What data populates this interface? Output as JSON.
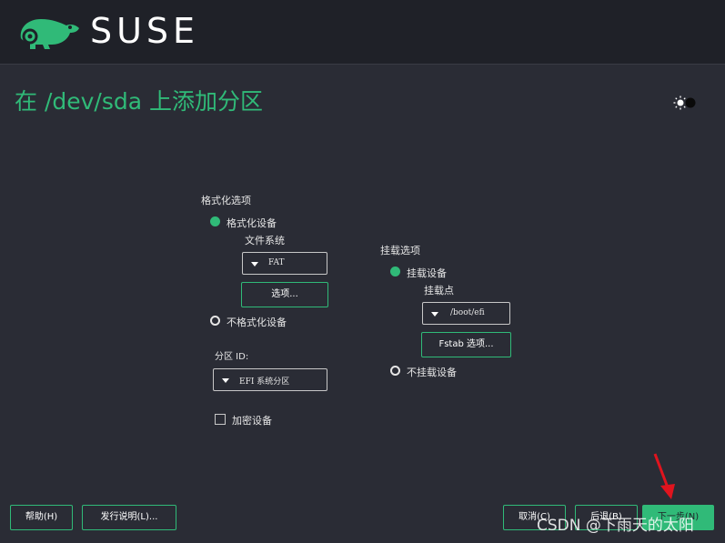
{
  "header": {
    "brand": "SUSE"
  },
  "page": {
    "title": "在 /dev/sda 上添加分区"
  },
  "format_section": {
    "label": "格式化选项",
    "format_device_label": "格式化设备",
    "filesystem_label": "文件系统",
    "filesystem_value": "FAT",
    "options_button": "选项...",
    "no_format_label": "不格式化设备",
    "partition_id_label": "分区 ID:",
    "partition_id_value": "EFI 系统分区",
    "encrypt_label": "加密设备"
  },
  "mount_section": {
    "label": "挂载选项",
    "mount_device_label": "挂载设备",
    "mount_point_label": "挂载点",
    "mount_point_value": "/boot/efi",
    "fstab_button": "Fstab 选项...",
    "no_mount_label": "不挂载设备"
  },
  "footer": {
    "help_button": "帮助(H)",
    "release_notes_button": "发行说明(L)...",
    "cancel_button": "取消(C)",
    "back_button": "后退(B)",
    "next_button": "下一步(N)"
  },
  "watermark": "CSDN @下雨天的太阳",
  "colors": {
    "accent": "#30ba78",
    "background": "#2a2c35",
    "header": "#1f2128"
  }
}
